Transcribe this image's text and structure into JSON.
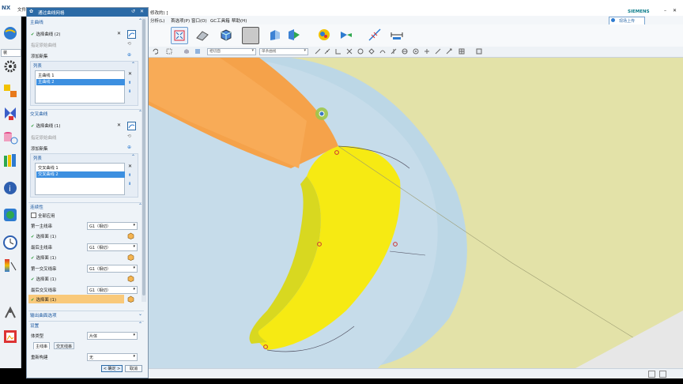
{
  "app": {
    "logo": "NX",
    "file_menu": "文件(F)",
    "doc_title": "修改的) ]",
    "brand": "SIEMENS",
    "upload_button": "现场上传"
  },
  "menus": [
    "分析(L)",
    "首选项(P)",
    "窗口(O)",
    "GC工具箱",
    "帮助(H)"
  ],
  "selection_bar": {
    "filter1": "相切面",
    "filter2": "单条曲线"
  },
  "left_bar": {
    "search_value": "装"
  },
  "dialog": {
    "title": "通过曲线网格",
    "primary_section": "主曲线",
    "primary_select": "选择曲线 (2)",
    "primary_origin": "指定原始曲线",
    "primary_add": "添加新集",
    "primary_list_header": "列表",
    "primary_list": [
      "主曲线 1",
      "主曲线 2"
    ],
    "cross_section": "交叉曲线",
    "cross_select": "选择曲线 (1)",
    "cross_origin": "指定原始曲线",
    "cross_add": "添加新集",
    "cross_list_header": "列表",
    "cross_list": [
      "交叉曲线 1",
      "交叉曲线 2"
    ],
    "continuity_section": "连续性",
    "apply_all": "全部应用",
    "first_primary": "第一主线串",
    "first_primary_value": "G1（相切）",
    "first_primary_face": "选择面 (1)",
    "last_primary": "最后主线串",
    "last_primary_value": "G1（相切）",
    "last_primary_face": "选择面 (1)",
    "first_cross": "第一交叉线串",
    "first_cross_value": "G1（相切）",
    "first_cross_face": "选择面 (1)",
    "last_cross": "最后交叉线串",
    "last_cross_value": "G1（相切）",
    "last_cross_face": "选择面 (1)",
    "output_section": "输出曲面选项",
    "settings_section": "设置",
    "body_type_label": "体类型",
    "body_type_value": "片体",
    "tab_primary": "主线串",
    "tab_cross": "交叉线串",
    "rebuild_label": "重新构建",
    "rebuild_value": "无",
    "ok_button": "< 确定 >",
    "cancel_button": "取消"
  },
  "colors": {
    "dialog_title_bg": "#2b6aa6",
    "selected_item": "#3c8fe0",
    "orange_surface": "#f5a24a",
    "yellow_surface": "#f6ea13",
    "blue_surface": "#bcd7e6",
    "bg_surface": "#e3e2a8"
  }
}
